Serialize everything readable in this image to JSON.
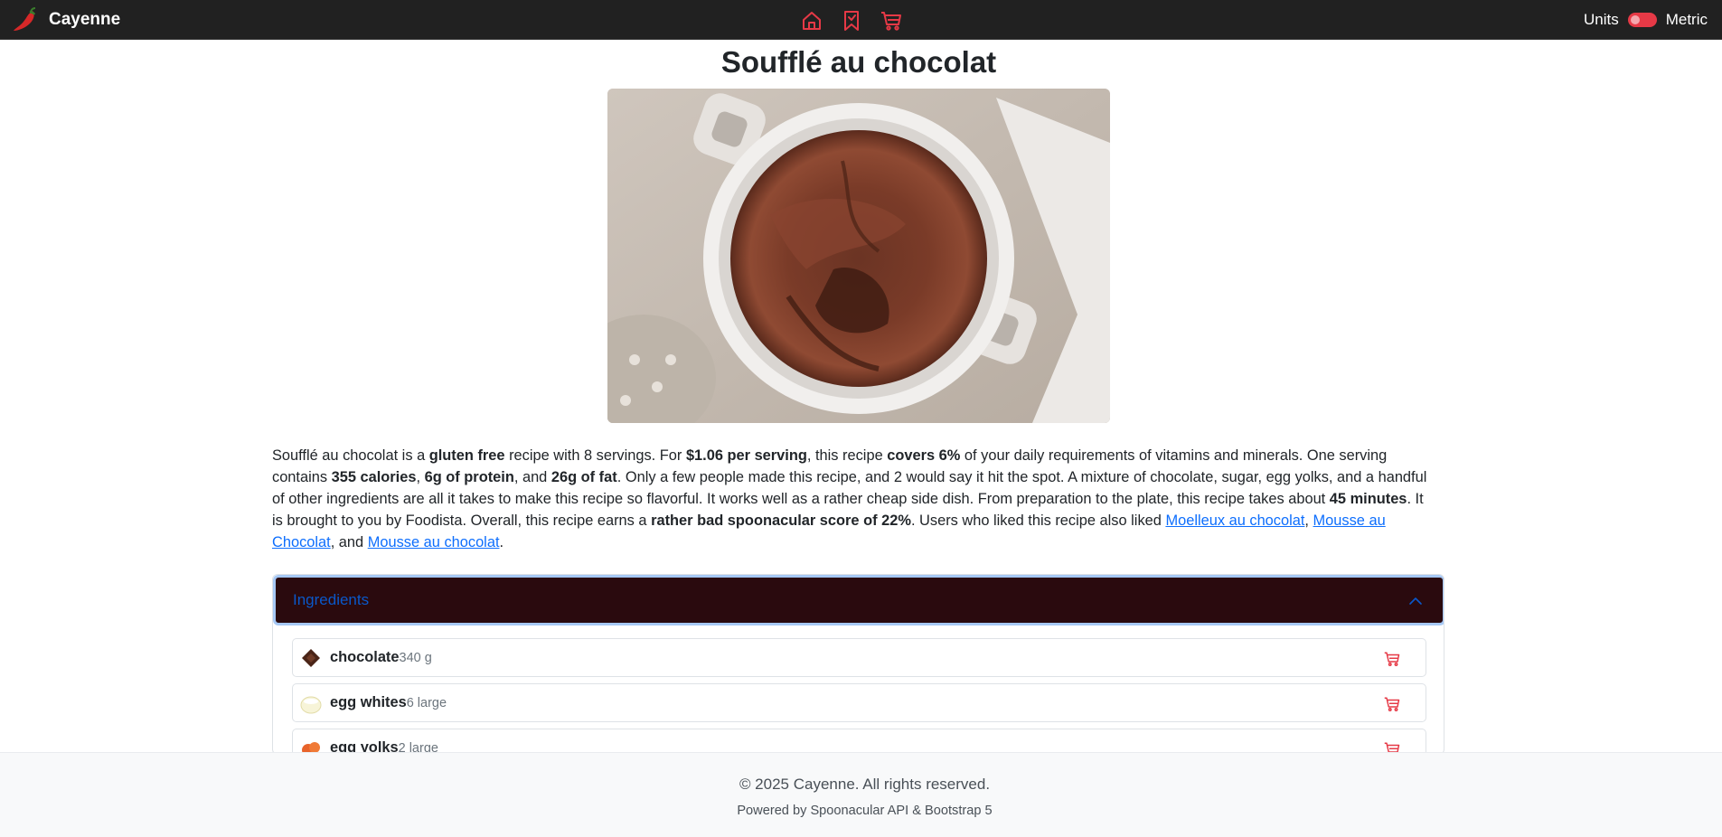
{
  "navbar": {
    "brand": "Cayenne",
    "brand_icon": "chili-pepper-icon",
    "icons": [
      "home-icon",
      "bookmark-icon",
      "cart-icon"
    ],
    "accent_color": "#e63946",
    "units_label": "Units",
    "units_value": "Metric",
    "units_toggle_on": false
  },
  "recipe": {
    "title": "Soufflé au chocolat",
    "summary": {
      "s1": "Soufflé au chocolat is a ",
      "b1": "gluten free",
      "s2": " recipe with 8 servings. For ",
      "b2": "$1.06 per serving",
      "s3": ", this recipe ",
      "b3": "covers 6%",
      "s4": " of your daily requirements of vitamins and minerals. One serving contains ",
      "b4": "355 calories",
      "s5": ", ",
      "b5": "6g of protein",
      "s6": ", and ",
      "b6": "26g of fat",
      "s7": ". Only a few people made this recipe, and 2 would say it hit the spot. A mixture of chocolate, sugar, egg yolks, and a handful of other ingredients are all it takes to make this recipe so flavorful. It works well as a rather cheap side dish. From preparation to the plate, this recipe takes about ",
      "b7": "45 minutes",
      "s8": ". It is brought to you by Foodista. Overall, this recipe earns a ",
      "b8": "rather bad spoonacular score of 22%",
      "s9": ". Users who liked this recipe also liked ",
      "link1": "Moelleux au chocolat",
      "s10": ", ",
      "link2": "Mousse au Chocolat",
      "s11": ", and ",
      "link3": "Mousse au chocolat",
      "s12": "."
    }
  },
  "ingredients": {
    "header": "Ingredients",
    "expanded": true,
    "items": [
      {
        "name": "chocolate",
        "amount": "340 g",
        "icon": "chocolate-icon"
      },
      {
        "name": "egg whites",
        "amount": "6 large",
        "icon": "egg-whites-icon"
      },
      {
        "name": "egg yolks",
        "amount": "2 large",
        "icon": "egg-yolks-icon"
      }
    ]
  },
  "footer": {
    "copyright": "© 2025 Cayenne. All rights reserved.",
    "powered": "Powered by Spoonacular API & Bootstrap 5"
  }
}
